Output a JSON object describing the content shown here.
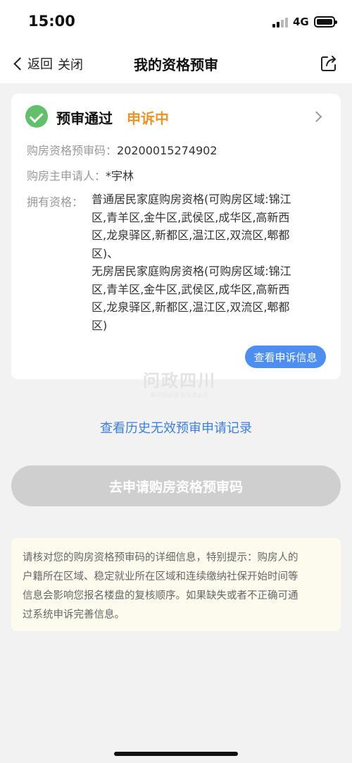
{
  "status_bar": {
    "time": "15:00",
    "network": "4G"
  },
  "nav": {
    "back_label": "返回",
    "close_label": "关闭",
    "title": "我的资格预审"
  },
  "card": {
    "status_title": "预审通过",
    "status_tag": "申诉中",
    "code_label": "购房资格预审码：",
    "code_value": "20200015274902",
    "applicant_label": "购房主申请人：",
    "applicant_value": "*宇林",
    "qualification_label": "拥有资格：",
    "qualification_lines": [
      "普通居民家庭购房资格(可购房区域:锦江",
      "区,青羊区,金牛区,武侯区,成华区,高新西",
      "区,龙泉驿区,新都区,温江区,双流区,郫都",
      "区)、",
      "无房居民家庭购房资格(可购房区域:锦江",
      "区,青羊区,金牛区,武侯区,成华区,高新西",
      "区,龙泉驿区,新都区,温江区,双流区,郫都",
      "区)"
    ],
    "appeal_button": "查看申诉信息"
  },
  "watermark": {
    "main": "问政四川",
    "sub": "有问题必回 有诉求必办"
  },
  "history_link": "查看历史无效预审申请记录",
  "apply_button": "去申请购房资格预审码",
  "notice": {
    "lines": [
      "请核对您的购房资格预审码的详细信息，特别提示：购房人的",
      "户籍所在区域、稳定就业所在区域和连续缴纳社保开始时间等",
      "信息会影响您报名楼盘的复核顺序。如果缺失或者不正确可通",
      "过系统申诉完善信息。"
    ]
  },
  "colors": {
    "accent_blue": "#4d8ff0",
    "link_blue": "#3c7fdc",
    "success_green": "#63bf6c",
    "warning_orange": "#e7952c",
    "disabled_gray": "#cfcfcf",
    "notice_bg": "#fdfbee"
  },
  "icons": {
    "back": "chevron-left-icon",
    "share": "share-icon",
    "status": "check-circle-icon",
    "card_more": "chevron-right-icon"
  }
}
